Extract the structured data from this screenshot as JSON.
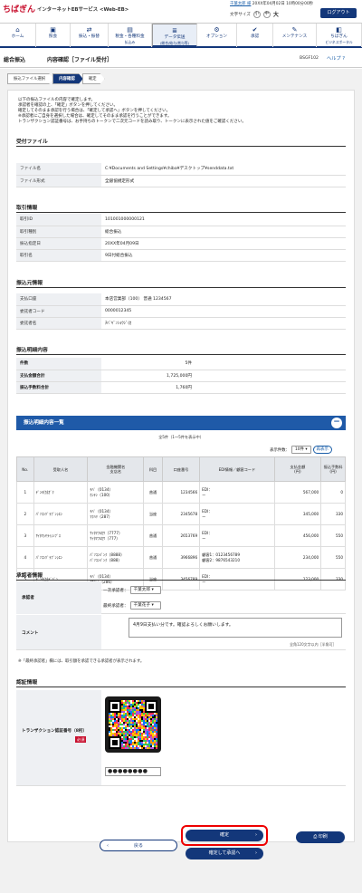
{
  "header": {
    "logo_name": "ちばぎん",
    "logo_service": "インターネットEBサービス <Web-EB>",
    "user_name": "千葉太郎 様",
    "last_login": "20XX年04月02日 10時00分00秒",
    "font_size_label": "文字サイズ",
    "font_small": "小",
    "font_medium": "中",
    "font_large": "大",
    "logout_label": "ログアウト"
  },
  "nav": [
    {
      "icon": "home-icon",
      "glyph": "⌂",
      "line1": "ホーム",
      "line2": ""
    },
    {
      "icon": "deposit-icon",
      "glyph": "▣",
      "line1": "照会",
      "line2": ""
    },
    {
      "icon": "transfer-icon",
      "glyph": "⇄",
      "line1": "振込・振替",
      "line2": ""
    },
    {
      "icon": "tax-icon",
      "glyph": "▤",
      "line1": "税金・各種料金",
      "line2": "払込み"
    },
    {
      "icon": "data-transfer-icon",
      "glyph": "≣",
      "line1": "データ伝送",
      "line2": "(総合/給与/賞与等)"
    },
    {
      "icon": "option-icon",
      "glyph": "⚙",
      "line1": "オプション",
      "line2": ""
    },
    {
      "icon": "approval-icon",
      "glyph": "✔",
      "line1": "承認",
      "line2": ""
    },
    {
      "icon": "maintenance-icon",
      "glyph": "✎",
      "line1": "メンテナンス",
      "line2": ""
    },
    {
      "icon": "portal-icon",
      "glyph": "◧",
      "line1": "ちばぎん",
      "line2": "ビジネスポータル"
    }
  ],
  "title": {
    "category": "総合振込",
    "page": "内容確認［ファイル受付］",
    "screen_code": "BSGF102",
    "help": "ヘルプ"
  },
  "steps": [
    "振込ファイル選択",
    "内容確認",
    "確定"
  ],
  "message": [
    "以下の振込ファイルの内容で確定します。",
    "承認者を確認の上、「確定」ボタンを押してください。",
    "確定してそのまま承認を行う場合は、「確定して承認へ」ボタンを押してください。",
    "※承認者にご自身を選択した場合は、確定してそのまま承認を行うことができます。",
    "トランザクション認証番号は、お手持ちのトークンで二次元コードを読み取り、トークンに表示された値をご確認ください。"
  ],
  "file_section": {
    "heading": "受付ファイル",
    "rows": [
      {
        "k": "ファイル名",
        "v": "C:¥Documents and Settings¥chiba¥デスクトップ¥senddata.txt"
      },
      {
        "k": "ファイル形式",
        "v": "全銀協規定形式"
      }
    ]
  },
  "trans_section": {
    "heading": "取引情報",
    "rows": [
      {
        "k": "取引ID",
        "v": "101001000000121"
      },
      {
        "k": "取引種別",
        "v": "総合振込"
      },
      {
        "k": "振込指定日",
        "v": "20XX年04月09日"
      },
      {
        "k": "取引名",
        "v": "9日付総合振込"
      }
    ]
  },
  "source_section": {
    "heading": "振込元情報",
    "rows": [
      {
        "k": "支払口座",
        "v": "本店営業部（100） 普通 1234567"
      },
      {
        "k": "委託者コード",
        "v": "0000012345"
      },
      {
        "k": "委託者名",
        "v": "ﾁﾊﾞｷﾞﾝｼｮｳｼﾞ(ｶ"
      }
    ]
  },
  "summary_section": {
    "heading": "振込明細内容",
    "rows": [
      {
        "k": "件数",
        "v": "5件"
      },
      {
        "k": "支払金額合計",
        "v": "1,725,000円"
      },
      {
        "k": "振込手数料合計",
        "v": "1,760円"
      }
    ]
  },
  "detail": {
    "heading": "振込明細内容一覧",
    "count_text": "全5件（1～5件を表示中）",
    "page_size_label": "表示件数：",
    "page_size_value": "10件",
    "show_button": "再表示",
    "columns": [
      "No.",
      "受取人名",
      "金融機関名\n支店名",
      "科目",
      "口座番号",
      "EDI情報／顧客コード",
      "支払金額\n(円)",
      "振込手数料\n(円)"
    ],
    "rows": [
      {
        "no": "1",
        "name": "ﾃﾞﾝｷ(ｶ)ｶﾞｸ",
        "bank": "ﾁﾊﾞ（0134）",
        "branch": "ﾎﾝﾃﾝ（100）",
        "type": "普通",
        "acct": "1234566",
        "edi1": "EDI：",
        "edi2": "ー",
        "amount": "567,000",
        "fee": "0"
      },
      {
        "no": "2",
        "name": "ﾊﾟｿｺﾝﾂﾞﾗﾌﾞﾝｼｴﾝ",
        "bank": "ﾁﾊﾞ（0134）",
        "branch": "ﾏｸﾊﾘ（287）",
        "type": "当座",
        "acct": "2345678",
        "edi1": "EDI：",
        "edi2": "ー",
        "amount": "345,000",
        "fee": "330"
      },
      {
        "no": "3",
        "name": "ｻｲﾀﾏｼﾔﾗｲｼﾝﾌﾞｽ",
        "bank": "ｻｲﾀﾏﾌﾙｶﾜ（7777）",
        "branch": "ｻｲﾀﾏﾌﾙｶﾜ（777）",
        "type": "普通",
        "acct": "2653769",
        "edi1": "EDI：",
        "edi2": "ー",
        "amount": "456,000",
        "fee": "550"
      },
      {
        "no": "4",
        "name": "ﾊﾟｿｺﾝﾂﾞﾗﾌﾞﾝｼｴﾝ",
        "bank": "ﾊﾟｿｺﾝﾊﾞﾝｸ（8888）",
        "branch": "ﾊﾟｿｺﾝﾊﾞﾝｸ（888）",
        "type": "普通",
        "acct": "3966896",
        "edi1": "顧客1：0123456789",
        "edi2": "顧客2：9876543210",
        "amount": "234,000",
        "fee": "550"
      },
      {
        "no": "5",
        "name": "ﾃﾞﾝｷ(ｶ)ﾃﾞﾊﾞﾝ",
        "bank": "ﾁﾊﾞ（0134）",
        "branch": "ﾌﾅﾊﾞｼ（286）",
        "type": "当座",
        "acct": "3456789",
        "edi1": "EDI：",
        "edi2": "ー",
        "amount": "123,000",
        "fee": "330"
      }
    ]
  },
  "approver": {
    "heading": "承認者情報",
    "label": "承認者",
    "first_label": "一次承認者：",
    "first_value": "千葉太郎",
    "final_label": "最終承認者：",
    "final_value": "千葉花子",
    "comment_label": "コメント",
    "comment_value": "4月9日支払い分です。確認よろしくお願いします。",
    "comment_limit": "全角120文字以内［半角可］",
    "note": "※「最終承認者」欄には、取引額を承認できる承認者が表示されます。"
  },
  "auth": {
    "heading": "認証情報",
    "label": "トランザクション認証番号（8桁）",
    "required": "必須",
    "password_value": "●●●●●●●●"
  },
  "buttons": {
    "back": "戻る",
    "confirm": "確定",
    "confirm_approve": "確定して承認へ",
    "print": "印刷"
  },
  "colors": {
    "brand_red": "#c8102e",
    "navy": "#13377a",
    "blue": "#1f5aa8"
  }
}
